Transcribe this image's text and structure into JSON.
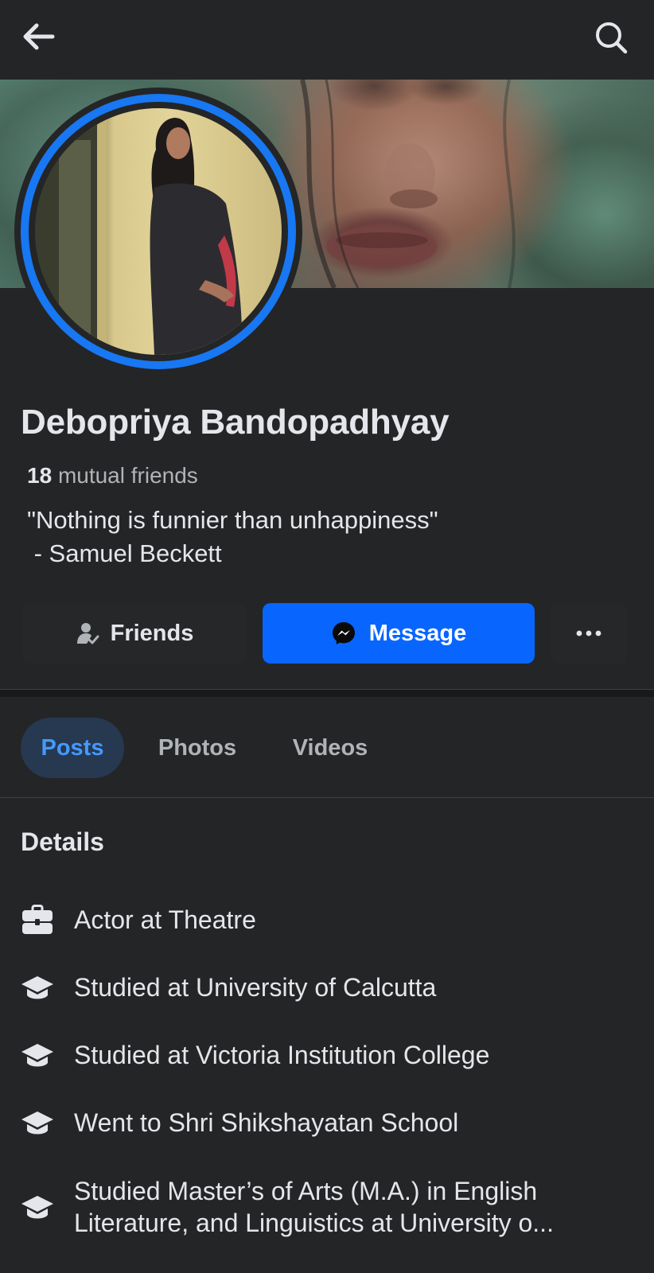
{
  "header": {
    "back_icon": "arrow-left-icon",
    "search_icon": "search-icon"
  },
  "profile": {
    "name": "Debopriya Bandopadhyay",
    "mutual_count": "18",
    "mutual_label": "mutual friends",
    "bio_line_1": "\"Nothing is funnier than unhappiness\"",
    "bio_line_2": " - Samuel Beckett",
    "ring_color": "#1877f2"
  },
  "actions": {
    "friends_label": "Friends",
    "message_label": "Message",
    "more_label": "···",
    "message_color": "#0866ff"
  },
  "tabs": [
    {
      "label": "Posts",
      "active": true
    },
    {
      "label": "Photos",
      "active": false
    },
    {
      "label": "Videos",
      "active": false
    }
  ],
  "details": {
    "title": "Details",
    "items": [
      {
        "icon": "briefcase-icon",
        "text": "Actor at Theatre"
      },
      {
        "icon": "graduation-cap-icon",
        "text": "Studied at University of Calcutta"
      },
      {
        "icon": "graduation-cap-icon",
        "text": "Studied at Victoria Institution College"
      },
      {
        "icon": "graduation-cap-icon",
        "text": "Went to Shri Shikshayatan School"
      },
      {
        "icon": "graduation-cap-icon",
        "text_line_1": "Studied Master’s of Arts (M.A.) in English",
        "text_line_2": "Literature, and Linguistics at University o..."
      }
    ]
  }
}
